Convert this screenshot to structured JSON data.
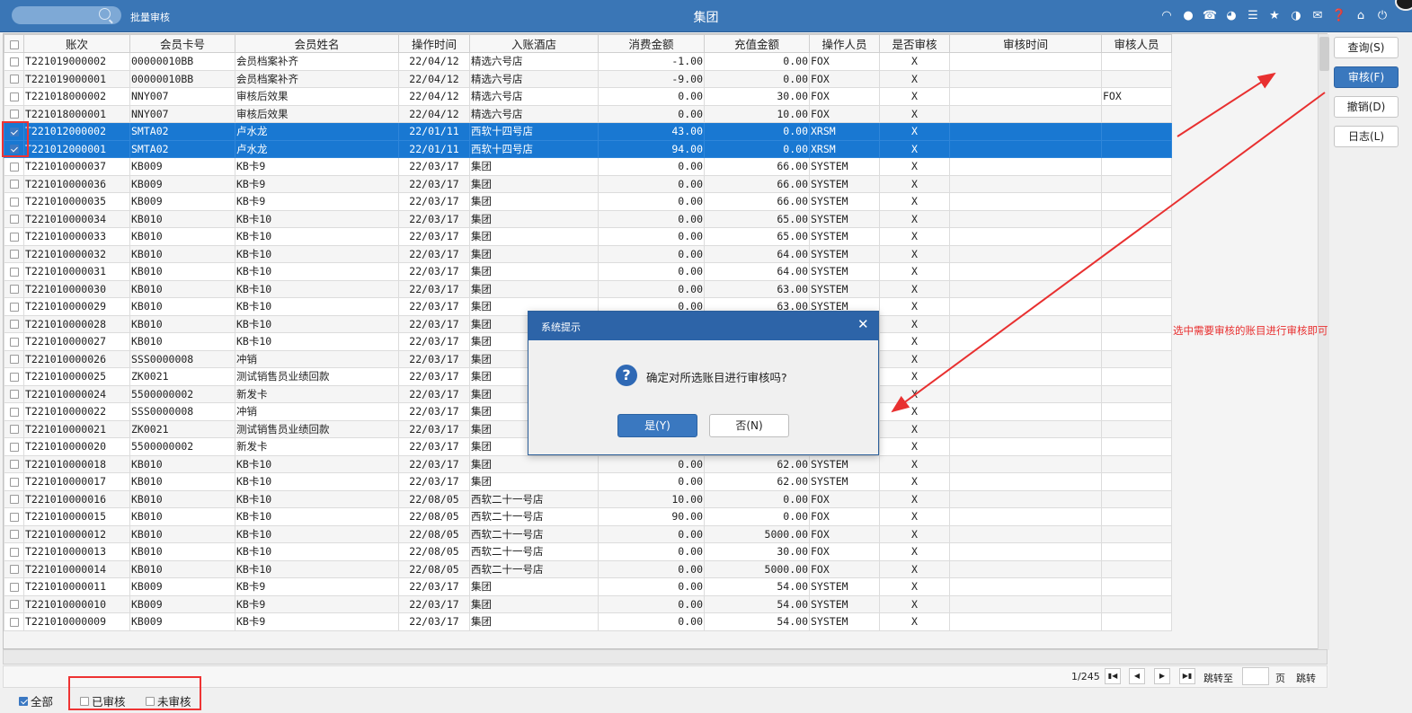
{
  "header": {
    "module": "批量审核",
    "title": "集团",
    "search_placeholder": ""
  },
  "toolbar_icons": [
    "wifi-icon",
    "chat-icon",
    "phone-icon",
    "palette-icon",
    "menu-icon",
    "star-icon",
    "theme-icon",
    "mail-icon",
    "help-icon",
    "home-icon",
    "power-icon"
  ],
  "columns": [
    "账次",
    "会员卡号",
    "会员姓名",
    "操作时间",
    "入账酒店",
    "消费金额",
    "充值金额",
    "操作人员",
    "是否审核",
    "审核时间",
    "审核人员"
  ],
  "rows": [
    {
      "checked": false,
      "cells": [
        "T221019000002",
        "00000010BB",
        "会员档案补齐",
        "22/04/12",
        "精选六号店",
        "-1.00",
        "0.00",
        "FOX",
        "X",
        "",
        ""
      ]
    },
    {
      "checked": false,
      "cells": [
        "T221019000001",
        "00000010BB",
        "会员档案补齐",
        "22/04/12",
        "精选六号店",
        "-9.00",
        "0.00",
        "FOX",
        "X",
        "",
        ""
      ]
    },
    {
      "checked": false,
      "cells": [
        "T221018000002",
        "NNY007",
        "审核后效果",
        "22/04/12",
        "精选六号店",
        "0.00",
        "30.00",
        "FOX",
        "X",
        "",
        "FOX"
      ]
    },
    {
      "checked": false,
      "cells": [
        "T221018000001",
        "NNY007",
        "审核后效果",
        "22/04/12",
        "精选六号店",
        "0.00",
        "10.00",
        "FOX",
        "X",
        "",
        ""
      ]
    },
    {
      "checked": true,
      "cells": [
        "T221012000002",
        "SMTA02",
        "卢水龙",
        "22/01/11",
        "西软十四号店",
        "43.00",
        "0.00",
        "XRSM",
        "X",
        "",
        ""
      ]
    },
    {
      "checked": true,
      "cells": [
        "T221012000001",
        "SMTA02",
        "卢水龙",
        "22/01/11",
        "西软十四号店",
        "94.00",
        "0.00",
        "XRSM",
        "X",
        "",
        ""
      ]
    },
    {
      "checked": false,
      "cells": [
        "T221010000037",
        "KB009",
        "KB卡9",
        "22/03/17",
        "集团",
        "0.00",
        "66.00",
        "SYSTEM",
        "X",
        "",
        ""
      ]
    },
    {
      "checked": false,
      "cells": [
        "T221010000036",
        "KB009",
        "KB卡9",
        "22/03/17",
        "集团",
        "0.00",
        "66.00",
        "SYSTEM",
        "X",
        "",
        ""
      ]
    },
    {
      "checked": false,
      "cells": [
        "T221010000035",
        "KB009",
        "KB卡9",
        "22/03/17",
        "集团",
        "0.00",
        "66.00",
        "SYSTEM",
        "X",
        "",
        ""
      ]
    },
    {
      "checked": false,
      "cells": [
        "T221010000034",
        "KB010",
        "KB卡10",
        "22/03/17",
        "集团",
        "0.00",
        "65.00",
        "SYSTEM",
        "X",
        "",
        ""
      ]
    },
    {
      "checked": false,
      "cells": [
        "T221010000033",
        "KB010",
        "KB卡10",
        "22/03/17",
        "集团",
        "0.00",
        "65.00",
        "SYSTEM",
        "X",
        "",
        ""
      ]
    },
    {
      "checked": false,
      "cells": [
        "T221010000032",
        "KB010",
        "KB卡10",
        "22/03/17",
        "集团",
        "0.00",
        "64.00",
        "SYSTEM",
        "X",
        "",
        ""
      ]
    },
    {
      "checked": false,
      "cells": [
        "T221010000031",
        "KB010",
        "KB卡10",
        "22/03/17",
        "集团",
        "0.00",
        "64.00",
        "SYSTEM",
        "X",
        "",
        ""
      ]
    },
    {
      "checked": false,
      "cells": [
        "T221010000030",
        "KB010",
        "KB卡10",
        "22/03/17",
        "集团",
        "0.00",
        "63.00",
        "SYSTEM",
        "X",
        "",
        ""
      ]
    },
    {
      "checked": false,
      "cells": [
        "T221010000029",
        "KB010",
        "KB卡10",
        "22/03/17",
        "集团",
        "0.00",
        "63.00",
        "SYSTEM",
        "X",
        "",
        ""
      ]
    },
    {
      "checked": false,
      "cells": [
        "T221010000028",
        "KB010",
        "KB卡10",
        "22/03/17",
        "集团",
        "",
        "",
        "",
        "X",
        "",
        ""
      ]
    },
    {
      "checked": false,
      "cells": [
        "T221010000027",
        "KB010",
        "KB卡10",
        "22/03/17",
        "集团",
        "",
        "",
        "",
        "X",
        "",
        ""
      ]
    },
    {
      "checked": false,
      "cells": [
        "T221010000026",
        "SSS0000008",
        "冲销",
        "22/03/17",
        "集团",
        "",
        "",
        "",
        "X",
        "",
        ""
      ]
    },
    {
      "checked": false,
      "cells": [
        "T221010000025",
        "ZK0021",
        "测试销售员业绩回款",
        "22/03/17",
        "集团",
        "",
        "",
        "",
        "X",
        "",
        ""
      ]
    },
    {
      "checked": false,
      "cells": [
        "T221010000024",
        "5500000002",
        "新发卡",
        "22/03/17",
        "集团",
        "",
        "",
        "",
        "X",
        "",
        ""
      ]
    },
    {
      "checked": false,
      "cells": [
        "T221010000022",
        "SSS0000008",
        "冲销",
        "22/03/17",
        "集团",
        "",
        "",
        "",
        "X",
        "",
        ""
      ]
    },
    {
      "checked": false,
      "cells": [
        "T221010000021",
        "ZK0021",
        "测试销售员业绩回款",
        "22/03/17",
        "集团",
        "",
        "",
        "",
        "X",
        "",
        ""
      ]
    },
    {
      "checked": false,
      "cells": [
        "T221010000020",
        "5500000002",
        "新发卡",
        "22/03/17",
        "集团",
        "",
        "",
        "",
        "X",
        "",
        ""
      ]
    },
    {
      "checked": false,
      "cells": [
        "T221010000018",
        "KB010",
        "KB卡10",
        "22/03/17",
        "集团",
        "0.00",
        "62.00",
        "SYSTEM",
        "X",
        "",
        ""
      ]
    },
    {
      "checked": false,
      "cells": [
        "T221010000017",
        "KB010",
        "KB卡10",
        "22/03/17",
        "集团",
        "0.00",
        "62.00",
        "SYSTEM",
        "X",
        "",
        ""
      ]
    },
    {
      "checked": false,
      "cells": [
        "T221010000016",
        "KB010",
        "KB卡10",
        "22/08/05",
        "西软二十一号店",
        "10.00",
        "0.00",
        "FOX",
        "X",
        "",
        ""
      ]
    },
    {
      "checked": false,
      "cells": [
        "T221010000015",
        "KB010",
        "KB卡10",
        "22/08/05",
        "西软二十一号店",
        "90.00",
        "0.00",
        "FOX",
        "X",
        "",
        ""
      ]
    },
    {
      "checked": false,
      "cells": [
        "T221010000012",
        "KB010",
        "KB卡10",
        "22/08/05",
        "西软二十一号店",
        "0.00",
        "5000.00",
        "FOX",
        "X",
        "",
        ""
      ]
    },
    {
      "checked": false,
      "cells": [
        "T221010000013",
        "KB010",
        "KB卡10",
        "22/08/05",
        "西软二十一号店",
        "0.00",
        "30.00",
        "FOX",
        "X",
        "",
        ""
      ]
    },
    {
      "checked": false,
      "cells": [
        "T221010000014",
        "KB010",
        "KB卡10",
        "22/08/05",
        "西软二十一号店",
        "0.00",
        "5000.00",
        "FOX",
        "X",
        "",
        ""
      ]
    },
    {
      "checked": false,
      "cells": [
        "T221010000011",
        "KB009",
        "KB卡9",
        "22/03/17",
        "集团",
        "0.00",
        "54.00",
        "SYSTEM",
        "X",
        "",
        ""
      ]
    },
    {
      "checked": false,
      "cells": [
        "T221010000010",
        "KB009",
        "KB卡9",
        "22/03/17",
        "集团",
        "0.00",
        "54.00",
        "SYSTEM",
        "X",
        "",
        ""
      ]
    },
    {
      "checked": false,
      "cells": [
        "T221010000009",
        "KB009",
        "KB卡9",
        "22/03/17",
        "集团",
        "0.00",
        "54.00",
        "SYSTEM",
        "X",
        "",
        ""
      ]
    }
  ],
  "sidebar": {
    "query": "查询(S)",
    "audit": "审核(F)",
    "cancel": "撤销(D)",
    "log": "日志(L)"
  },
  "pager": {
    "info": "1/245",
    "jump_label": "跳转至",
    "page_unit": "页",
    "go": "跳转"
  },
  "filters": {
    "all": "全部",
    "audited": "已审核",
    "unaudited": "未审核"
  },
  "annotation": "选中需要审核的账目进行审核即可",
  "dialog": {
    "title": "系统提示",
    "message": "确定对所选账目进行审核吗?",
    "yes": "是(Y)",
    "no": "否(N)"
  },
  "colors": {
    "titlebar": "#3a76b6",
    "selection": "#1978d2",
    "annotation": "#e83030"
  }
}
